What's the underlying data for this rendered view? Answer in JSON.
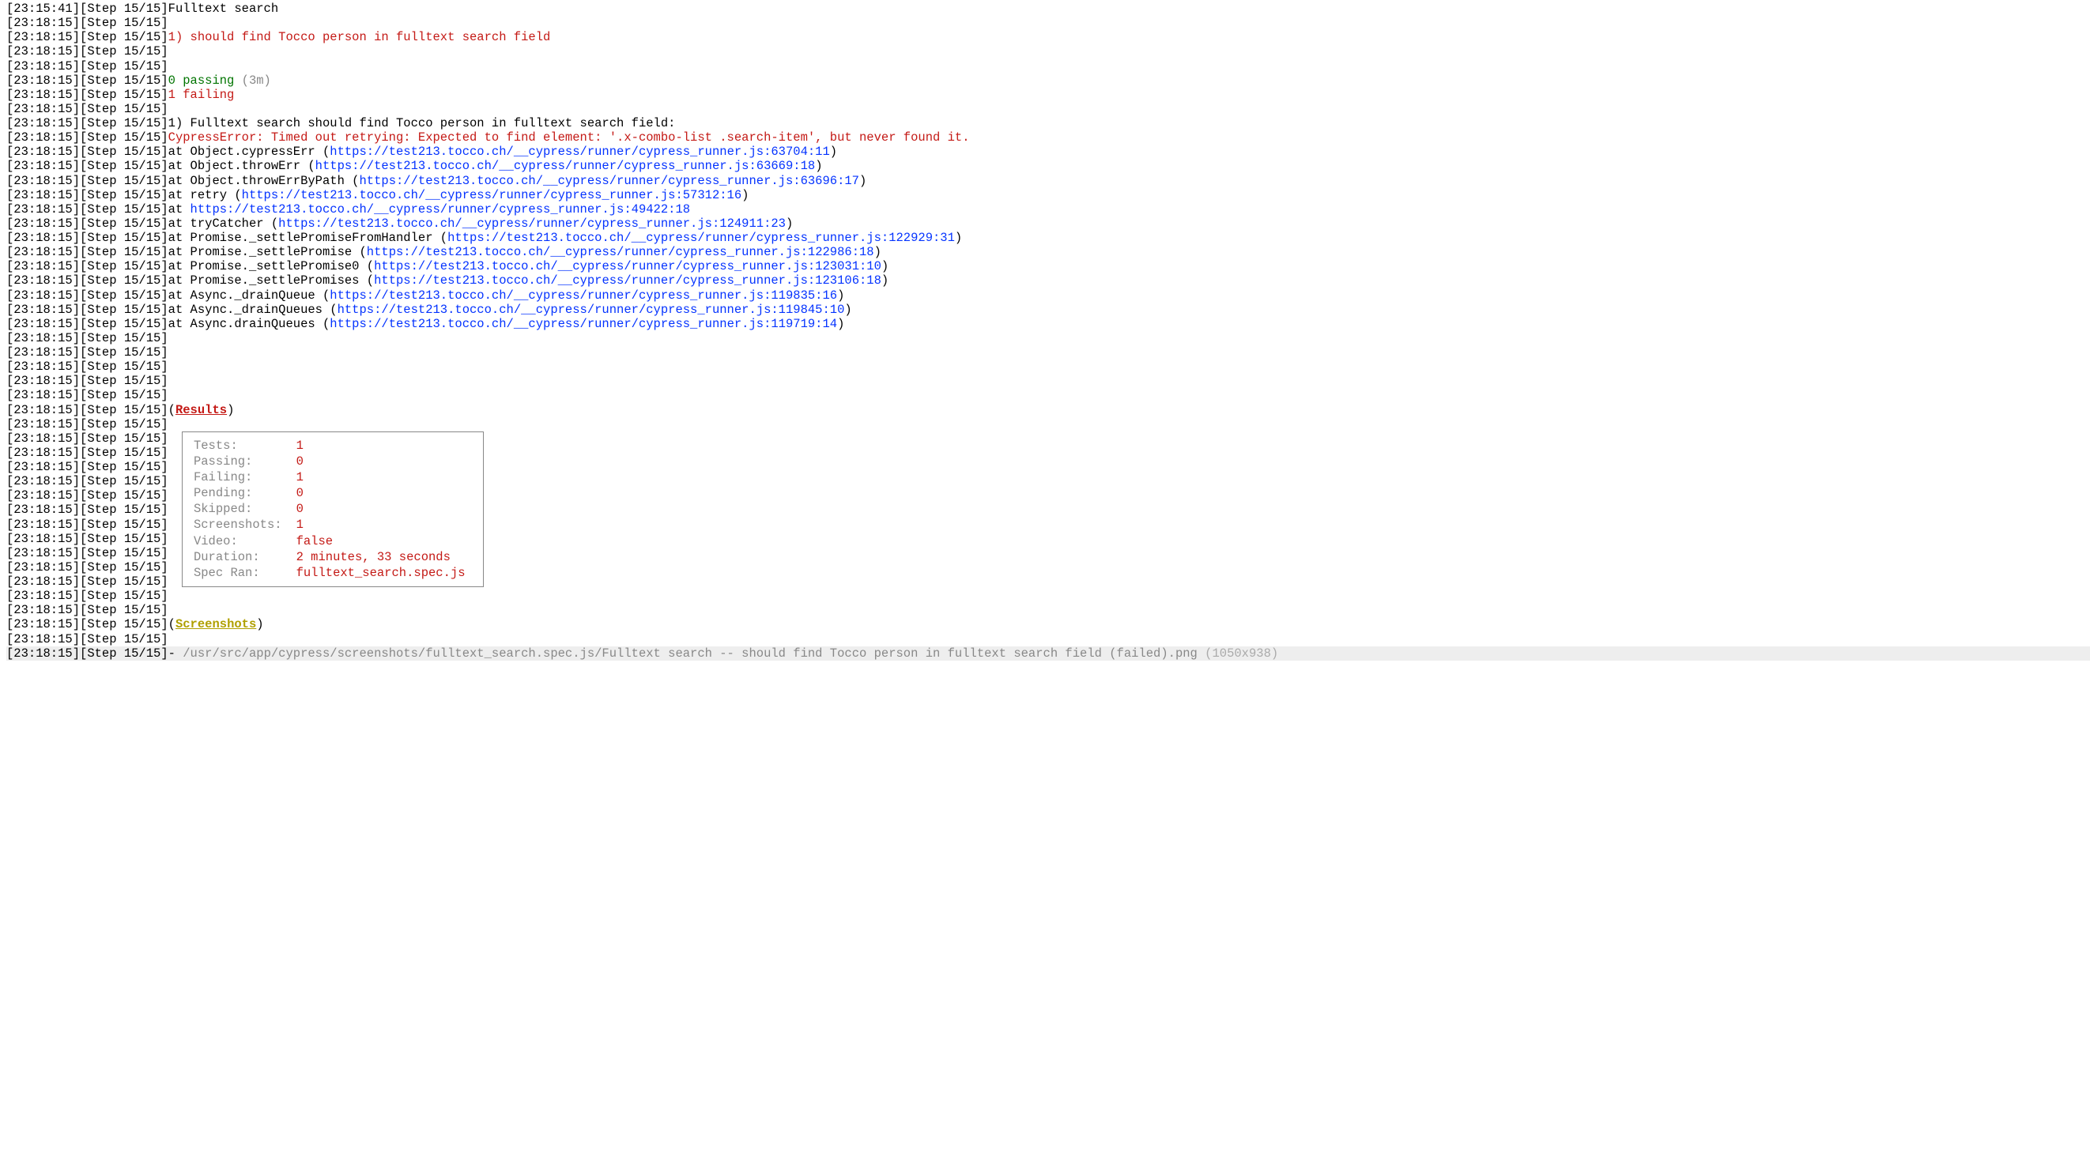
{
  "timestamps": {
    "first": "[23:15:41]",
    "rest": "[23:18:15]"
  },
  "step": "[Step 15/15]",
  "sp_ts_step": "   ",
  "ind4": "    ",
  "ind6": "      ",
  "ind2": "  ",
  "suite_name": "Fulltext search",
  "test_line_prefix": "1) ",
  "test_line": "should find Tocco person in fulltext search field",
  "summary": {
    "passing_count": "0 passing ",
    "passing_time": "(3m)",
    "failing_count": "1 failing"
  },
  "fail_header": "1) Fulltext search should find Tocco person in fulltext search field:",
  "cypress_error": "CypressError: Timed out retrying: Expected to find element: '.x-combo-list .search-item', but never found it.",
  "stack": [
    {
      "pre": "at Object.cypressErr (",
      "url": "https://test213.tocco.ch/__cypress/runner/cypress_runner.js:63704:11",
      "post": ")"
    },
    {
      "pre": "at Object.throwErr (",
      "url": "https://test213.tocco.ch/__cypress/runner/cypress_runner.js:63669:18",
      "post": ")"
    },
    {
      "pre": "at Object.throwErrByPath (",
      "url": "https://test213.tocco.ch/__cypress/runner/cypress_runner.js:63696:17",
      "post": ")"
    },
    {
      "pre": "at retry (",
      "url": "https://test213.tocco.ch/__cypress/runner/cypress_runner.js:57312:16",
      "post": ")"
    },
    {
      "pre": "at ",
      "url": "https://test213.tocco.ch/__cypress/runner/cypress_runner.js:49422:18",
      "post": ""
    },
    {
      "pre": "at tryCatcher (",
      "url": "https://test213.tocco.ch/__cypress/runner/cypress_runner.js:124911:23",
      "post": ")"
    },
    {
      "pre": "at Promise._settlePromiseFromHandler (",
      "url": "https://test213.tocco.ch/__cypress/runner/cypress_runner.js:122929:31",
      "post": ")"
    },
    {
      "pre": "at Promise._settlePromise (",
      "url": "https://test213.tocco.ch/__cypress/runner/cypress_runner.js:122986:18",
      "post": ")"
    },
    {
      "pre": "at Promise._settlePromise0 (",
      "url": "https://test213.tocco.ch/__cypress/runner/cypress_runner.js:123031:10",
      "post": ")"
    },
    {
      "pre": "at Promise._settlePromises (",
      "url": "https://test213.tocco.ch/__cypress/runner/cypress_runner.js:123106:18",
      "post": ")"
    },
    {
      "pre": "at Async._drainQueue (",
      "url": "https://test213.tocco.ch/__cypress/runner/cypress_runner.js:119835:16",
      "post": ")"
    },
    {
      "pre": "at Async._drainQueues (",
      "url": "https://test213.tocco.ch/__cypress/runner/cypress_runner.js:119845:10",
      "post": ")"
    },
    {
      "pre": "at Async.drainQueues (",
      "url": "https://test213.tocco.ch/__cypress/runner/cypress_runner.js:119719:14",
      "post": ")"
    }
  ],
  "results_heading": "Results",
  "results": [
    {
      "label": "Tests:",
      "value": "1"
    },
    {
      "label": "Passing:",
      "value": "0"
    },
    {
      "label": "Failing:",
      "value": "1"
    },
    {
      "label": "Pending:",
      "value": "0"
    },
    {
      "label": "Skipped:",
      "value": "0"
    },
    {
      "label": "Screenshots:",
      "value": "1"
    },
    {
      "label": "Video:",
      "value": "false"
    },
    {
      "label": "Duration:",
      "value": "2 minutes, 33 seconds"
    },
    {
      "label": "Spec Ran:",
      "value": "fulltext_search.spec.js"
    }
  ],
  "screenshots_heading": "Screenshots",
  "screenshot_line_prefix": " - ",
  "screenshot_path": "/usr/src/app/cypress/screenshots/fulltext_search.spec.js/Fulltext search -- should find Tocco person in fulltext search field (failed).png ",
  "screenshot_dims": "(1050x938)",
  "paren_open": "(",
  "paren_close": ")"
}
